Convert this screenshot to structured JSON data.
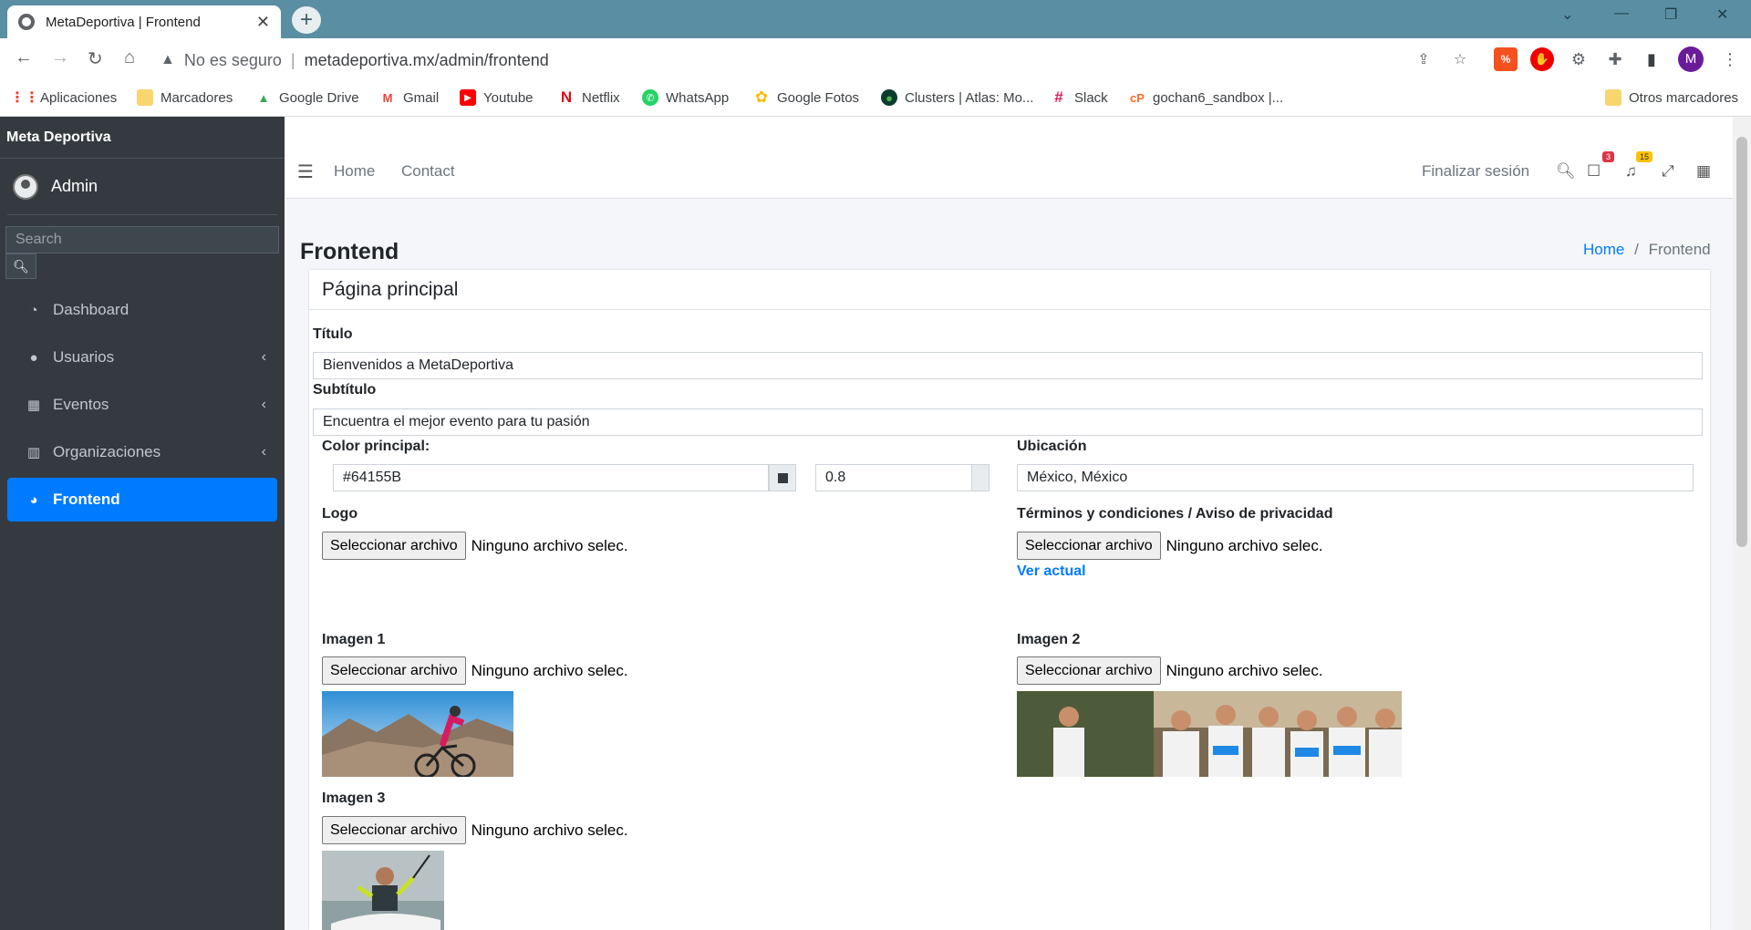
{
  "browser": {
    "tab_title": "MetaDeportiva | Frontend",
    "security_label": "No es seguro",
    "url": "metadeportiva.mx/admin/frontend",
    "profile_initial": "M",
    "bookmarks": [
      {
        "label": "Aplicaciones",
        "icon": "apps-grid-icon"
      },
      {
        "label": "Marcadores",
        "icon": "folder-icon"
      },
      {
        "label": "Google Drive",
        "icon": "drive-icon"
      },
      {
        "label": "Gmail",
        "icon": "gmail-icon"
      },
      {
        "label": "Youtube",
        "icon": "youtube-icon"
      },
      {
        "label": "Netflix",
        "icon": "netflix-icon"
      },
      {
        "label": "WhatsApp",
        "icon": "whatsapp-icon"
      },
      {
        "label": "Google Fotos",
        "icon": "photos-icon"
      },
      {
        "label": "Clusters | Atlas: Mo...",
        "icon": "mongodb-icon"
      },
      {
        "label": "Slack",
        "icon": "slack-icon"
      },
      {
        "label": "gochan6_sandbox |...",
        "icon": "cpanel-icon"
      }
    ],
    "other_bookmarks": "Otros marcadores"
  },
  "sidebar": {
    "brand": "Meta Deportiva",
    "user": "Admin",
    "search_placeholder": "Search",
    "items": [
      {
        "label": "Dashboard",
        "icon": "dashboard-icon",
        "has_children": false
      },
      {
        "label": "Usuarios",
        "icon": "user-icon",
        "has_children": true
      },
      {
        "label": "Eventos",
        "icon": "calendar-icon",
        "has_children": true
      },
      {
        "label": "Organizaciones",
        "icon": "building-icon",
        "has_children": true
      },
      {
        "label": "Frontend",
        "icon": "palette-icon",
        "has_children": false,
        "active": true
      }
    ]
  },
  "topnav": {
    "home": "Home",
    "contact": "Contact",
    "logout": "Finalizar sesión",
    "messages_count": "3",
    "notifications_count": "15"
  },
  "page": {
    "title": "Frontend",
    "breadcrumb_home": "Home",
    "breadcrumb_sep": "/",
    "breadcrumb_current": "Frontend"
  },
  "form": {
    "card_title": "Página principal",
    "titulo_label": "Título",
    "titulo_value": "Bienvenidos a MetaDeportiva",
    "subtitulo_label": "Subtítulo",
    "subtitulo_value": "Encuentra el mejor evento para tu pasión",
    "color_label": "Color principal:",
    "color_value": "#64155B",
    "opacity_value": "0.8",
    "ubicacion_label": "Ubicación",
    "ubicacion_value": "México, México",
    "logo_label": "Logo",
    "terminos_label": "Términos y condiciones / Aviso de privacidad",
    "ver_actual": "Ver actual",
    "imagen1_label": "Imagen 1",
    "imagen2_label": "Imagen 2",
    "imagen3_label": "Imagen 3",
    "file_button": "Seleccionar archivo",
    "no_file": "Ninguno archivo selec."
  }
}
